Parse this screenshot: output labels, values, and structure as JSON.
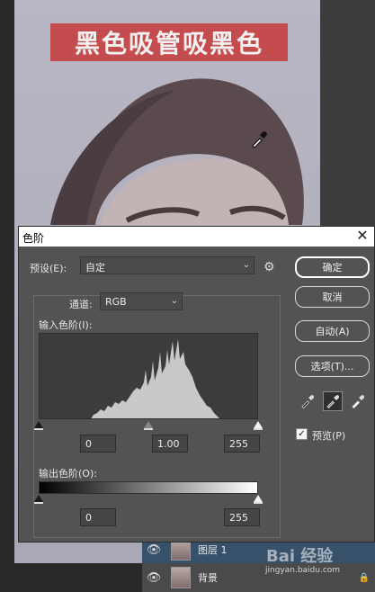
{
  "banner": {
    "text": "黑色吸管吸黑色",
    "color": "#c44b4e"
  },
  "dialog": {
    "title": "色阶",
    "preset_label": "预设(E):",
    "preset_value": "自定",
    "channel_label": "通道:",
    "channel_value": "RGB",
    "input_levels_label": "输入色阶(I):",
    "input_black": "0",
    "input_gamma": "1.00",
    "input_white": "255",
    "output_levels_label": "输出色阶(O):",
    "output_black": "0",
    "output_white": "255",
    "buttons": {
      "ok": "确定",
      "cancel": "取消",
      "auto": "自动(A)",
      "options": "选项(T)..."
    },
    "preview_label": "预览(P)",
    "preview_checked": true,
    "icons": {
      "close": "close-icon",
      "settings": "gear-icon",
      "black_point": "eyedropper-black-icon",
      "gray_point": "eyedropper-gray-icon",
      "white_point": "eyedropper-white-icon"
    }
  },
  "layers": [
    {
      "name": "图层 1",
      "selected": true
    },
    {
      "name": "背景",
      "selected": false
    }
  ],
  "watermark": {
    "text": "Bai 经验",
    "url": "jingyan.baidu.com"
  }
}
